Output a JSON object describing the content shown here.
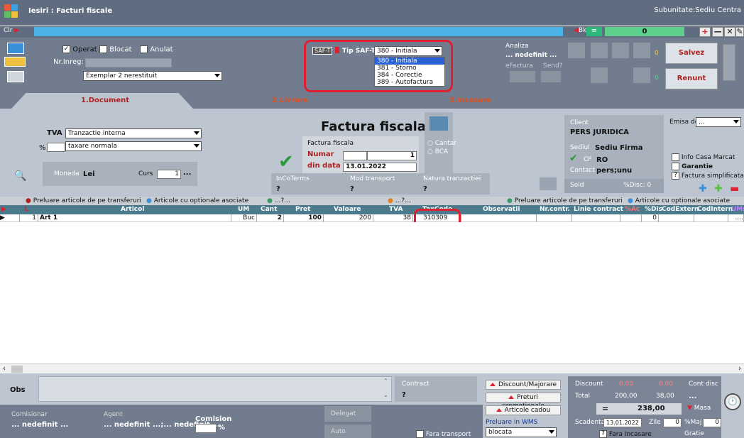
{
  "window": {
    "title": "Iesiri : Facturi fiscale",
    "subunitate": "Subunitate:Sediu Centra"
  },
  "toolbar": {
    "clr": "Clr",
    "bk": "Bk",
    "eq": "=",
    "counter": "0",
    "plus": "+",
    "minus": "—",
    "close": "✕",
    "pen": "✎"
  },
  "header": {
    "operat": "Operat",
    "blocat": "Blocat",
    "anulat": "Anulat",
    "nr_inreg_label": "Nr.Inreg:",
    "exemplar": "Exemplar 2 nerestituit",
    "saft_badge": "SAF-T",
    "tip_saft": "Tip SAF-T",
    "tip_value": "380 - Initiala",
    "tip_options": [
      "380 - Initiala",
      "381 - Storno",
      "384 - Corectie",
      "389 - Autofactura"
    ],
    "analiza": "Analiza",
    "nedefinit": "... nedefinit ...",
    "efactura": "eFactura",
    "send": "Send?",
    "zero1": "0",
    "zero2": "0",
    "salvez": "Salvez",
    "renunt": "Renunt"
  },
  "tabs": {
    "document": "1.Document",
    "livrare": "2.Livrare",
    "incasare": "3.Incasare"
  },
  "doc": {
    "tva_label": "TVA",
    "tva_value": "Tranzactie interna",
    "pct_label": "%",
    "taxare": "taxare normala",
    "title": "Factura fiscala",
    "sub_title": "Factura fiscala",
    "numar_label": "Numar",
    "numar": "1",
    "din_data_label": "din data",
    "din_data": "13.01.2022",
    "cantar": "Cantar",
    "bca": "BCA",
    "moneda_label": "Moneda",
    "moneda": "Lei",
    "curs_label": "Curs",
    "curs": "1",
    "incoterms": "InCoTerms",
    "mod_transport": "Mod transport",
    "natura": "Natura tranzactiei",
    "q1": "?",
    "q2": "?",
    "q3": "?",
    "client_label": "Client",
    "client": "PERS JURIDICA",
    "sediul_label": "Sediul",
    "sediul": "Sediu Firma",
    "cf_label": "CF",
    "cf": "RO",
    "contact_label": "Contact",
    "contact": "pers;unu",
    "sold_label": "Sold",
    "disc_label": "%Disc: 0",
    "emisa_label": "Emisa de",
    "emisa": "...",
    "info_casa": "Info Casa Marcat",
    "garantie": "Garantie",
    "factura_simpl": "Factura simplificata"
  },
  "gray_row": {
    "preluare1": "Preluare articole de pe transferuri",
    "articole1": "Articole cu optionale asociate",
    "dots1": "...?...",
    "dots2": "...?...",
    "preluare2": "Preluare articole de pe transferuri",
    "articole2": "Articole cu optionale asociate"
  },
  "grid": {
    "headers": [
      "L",
      "Articol",
      "UM",
      "Cant",
      "Pret",
      "Valoare",
      "TVA",
      "TaxCode",
      "Observatii",
      "Nr.contr.",
      "Linie contract",
      "%Ac",
      "%Dis",
      "CodExtern",
      "CodIntern",
      "UMs"
    ],
    "row": {
      "nr": "1",
      "articol": "Art 1",
      "um": "Buc",
      "cant": "2",
      "pret": "100",
      "valoare": "200",
      "tva": "38",
      "taxcode": "310309",
      "disc": "0",
      "dots": "...."
    }
  },
  "footer": {
    "obs": "Obs",
    "contract_label": "Contract",
    "contract": "?",
    "discount_majorare": "Discount/Majorare",
    "preturi_promo": "Preturi promotionale",
    "articole_cadou": "Articole cadou",
    "preluare_wms": "Preluare in WMS",
    "blocata": "blocata",
    "discount_label": "Discount",
    "disc1": "0,00",
    "disc2": "0,00",
    "total_label": "Total",
    "total1": "200,00",
    "total2": "38,00",
    "grand": "238,00",
    "masa": "Masa",
    "cont_disc": "Cont disc",
    "cont_disc_val": "...",
    "scadenta_label": "Scadenta",
    "scadenta": "13.01.2022",
    "zile_label": "Zile",
    "zile": "0",
    "maj_label": "%Maj",
    "maj": "0",
    "fara_incasare": "Fara incasare",
    "gratie": "Gratie",
    "comisionar": "Comisionar",
    "agent": "Agent",
    "comision": "Comision",
    "nedef1": "... nedefinit ...",
    "nedef2": "... nedefinit ...;... nedefinit ...",
    "pct": "%",
    "delegat": "Delegat",
    "auto": "Auto",
    "fara_transport": "Fara transport"
  }
}
